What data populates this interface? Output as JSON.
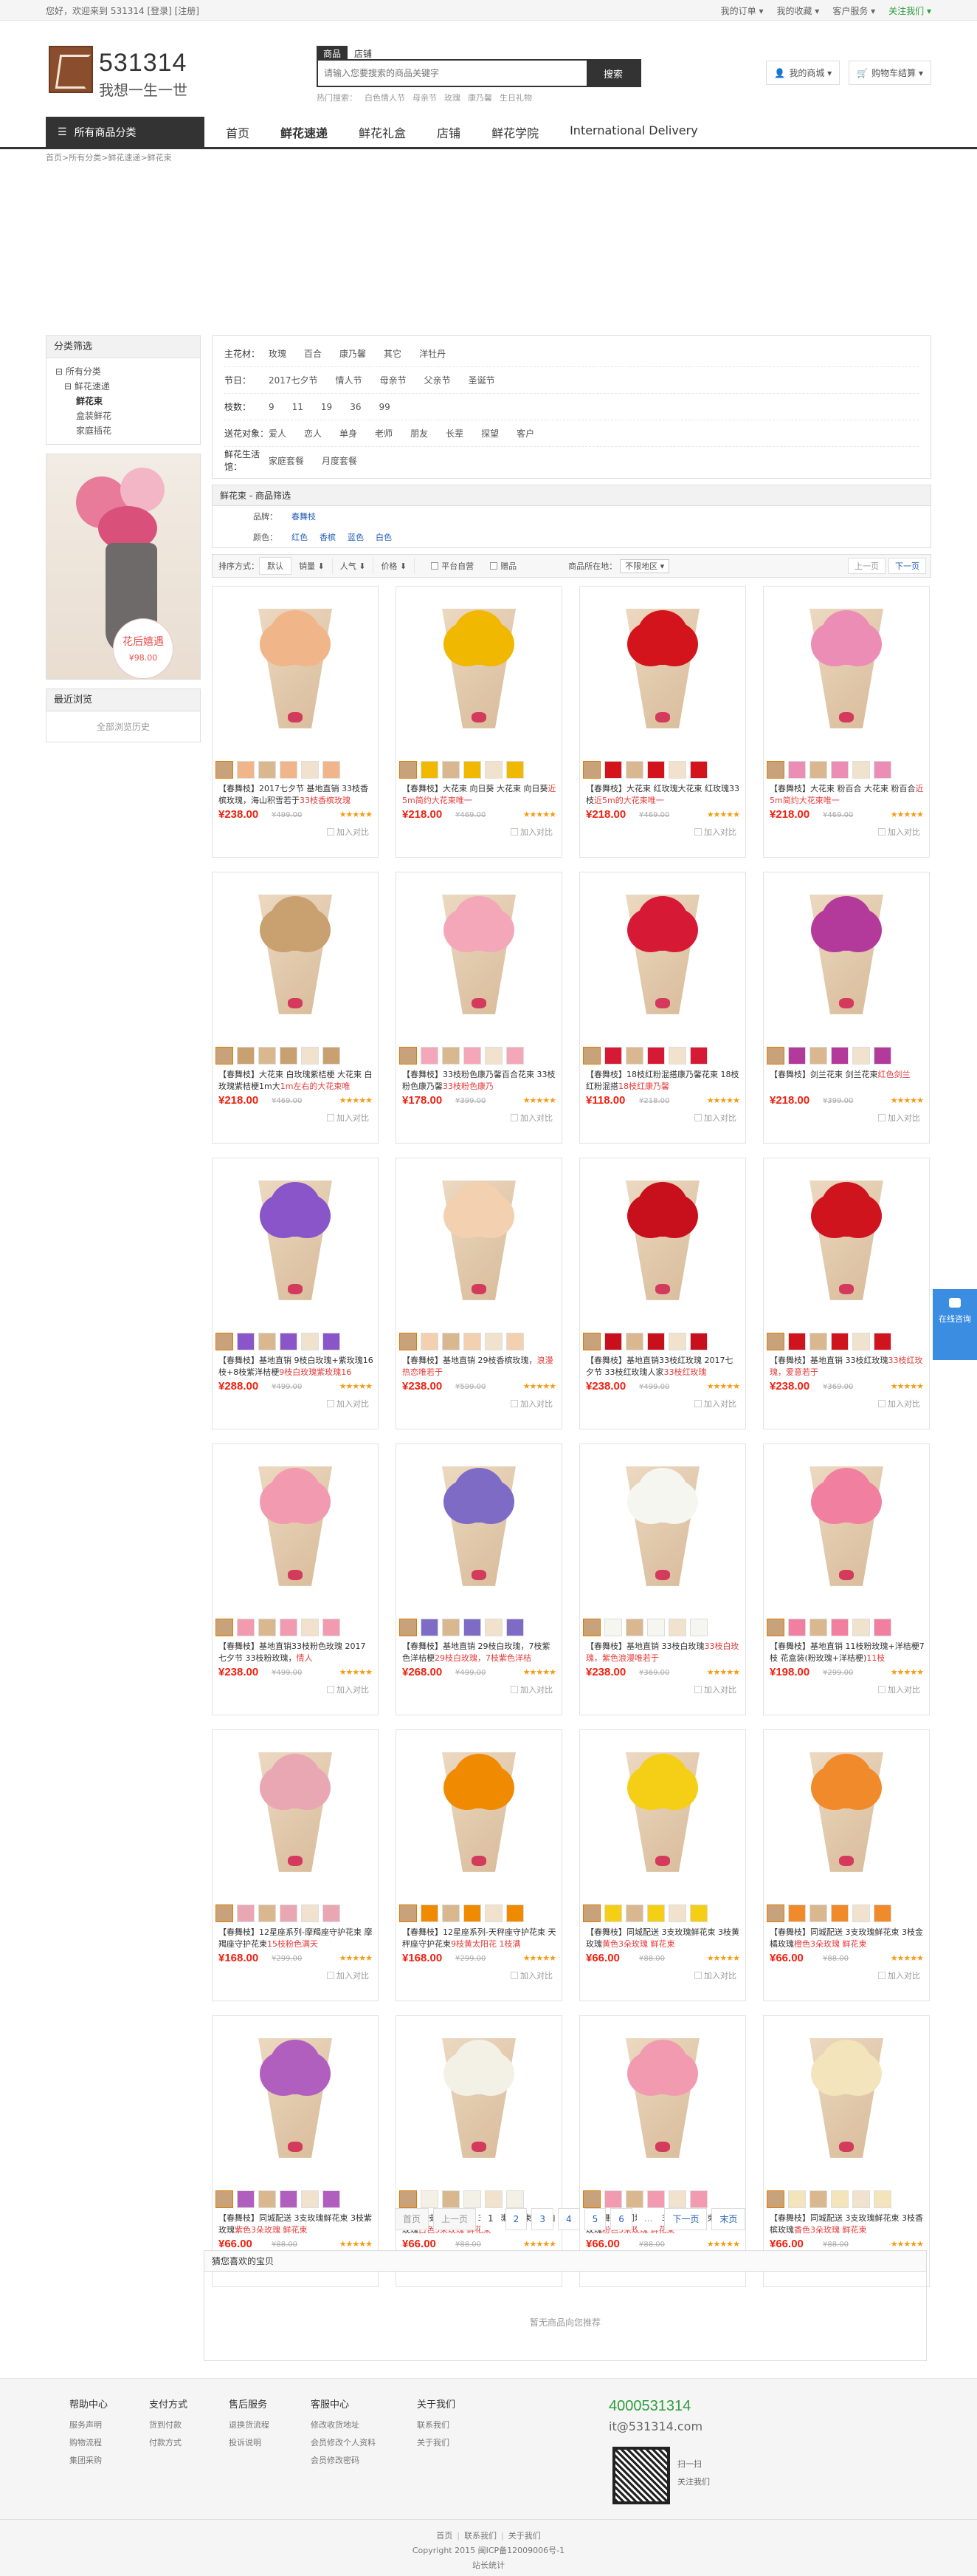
{
  "topbar": {
    "greeting": "您好，欢迎来到 531314 [登录] [注册]",
    "links": [
      "我的订单 ▾",
      "我的收藏 ▾",
      "客户服务 ▾",
      "关注我们 ▾"
    ]
  },
  "header": {
    "logo_num": "531314",
    "slogan": "我想一生一世",
    "tabs": [
      "商品",
      "店铺"
    ],
    "search_placeholder": "请输入您要搜索的商品关键字",
    "search_btn": "搜索",
    "hot_label": "热门搜索：",
    "hot": [
      "白色情人节",
      "母亲节",
      "玫瑰",
      "康乃馨",
      "生日礼物"
    ],
    "mall_btn": "我的商城 ▾",
    "cart_btn": "购物车结算 ▾"
  },
  "nav": {
    "allcat": "所有商品分类",
    "items": [
      "首页",
      "鲜花速递",
      "鲜花礼盒",
      "店铺",
      "鲜花学院",
      "International Delivery"
    ]
  },
  "breadcrumb": [
    "首页",
    "所有分类",
    "鲜花速递",
    "鲜花束"
  ],
  "sidebar": {
    "cat_title": "分类筛选",
    "tree": [
      [
        "l1",
        "⊟ 所有分类"
      ],
      [
        "l2",
        "⊟ 鲜花速递"
      ],
      [
        "l3 on",
        "鲜花束"
      ],
      [
        "l3",
        "盒装鲜花"
      ],
      [
        "l3",
        "家庭插花"
      ]
    ],
    "history_title": "最近浏览",
    "history_text": "全部浏览历史",
    "promo": {
      "line1": "花后嬉遇",
      "line2": "¥98.00"
    }
  },
  "filters": [
    {
      "k": "主花材：",
      "v": [
        "玫瑰",
        "百合",
        "康乃馨",
        "其它",
        "洋牡丹"
      ]
    },
    {
      "k": "节日：",
      "v": [
        "2017七夕节",
        "情人节",
        "母亲节",
        "父亲节",
        "圣诞节"
      ]
    },
    {
      "k": "枝数：",
      "v": [
        "9",
        "11",
        "19",
        "36",
        "99"
      ]
    },
    {
      "k": "送花对象：",
      "v": [
        "爱人",
        "恋人",
        "单身",
        "老师",
        "朋友",
        "长辈",
        "探望",
        "客户"
      ]
    },
    {
      "k": "鲜花生活馆：",
      "v": [
        "家庭套餐",
        "月度套餐"
      ]
    }
  ],
  "screen": {
    "title": "鲜花束 - 商品筛选",
    "rows": [
      {
        "k": "品牌：",
        "v": [
          "春舞枝"
        ]
      },
      {
        "k": "颜色：",
        "v": [
          "红色",
          "香槟",
          "蓝色",
          "白色"
        ]
      }
    ]
  },
  "sort": {
    "label": "排序方式：",
    "opts": [
      "默认",
      "销量 ⬇",
      "人气 ⬇",
      "价格 ⬇"
    ],
    "chk": [
      "平台自营",
      "赠品"
    ],
    "loc": "商品所在地：",
    "loc_val": "不限地区 ▾",
    "prev": "上一页",
    "next": "下一页"
  },
  "products": [
    {
      "c": "#f1b58a",
      "t": "【春舞枝】2017七夕节 基地直销 33枝香槟玫瑰，海山积雪若于",
      "h": "33枝香槟玫瑰",
      "p": "¥238.00",
      "o": "¥499.00"
    },
    {
      "c": "#f0b800",
      "t": "【春舞枝】大花束 向日葵 大花束 向日葵",
      "h": "近5m简约大花束唯一",
      "p": "¥218.00",
      "o": "¥469.00"
    },
    {
      "c": "#d3141c",
      "t": "【春舞枝】大花束 红玫瑰大花束 红玫瑰33枝",
      "h": "近5m的大花束唯一",
      "p": "¥218.00",
      "o": "¥469.00"
    },
    {
      "c": "#ec8db6",
      "t": "【春舞枝】大花束 粉百合 大花束 粉百合",
      "h": "近5m简约大花束唯一",
      "p": "¥218.00",
      "o": "¥469.00"
    },
    {
      "c": "#c9a070",
      "t": "【春舞枝】大花束 白玫瑰紫桔梗 大花束 白玫瑰紫桔梗1m大",
      "h": "1m左右的大花束唯",
      "p": "¥218.00",
      "o": "¥469.00"
    },
    {
      "c": "#f4a7b9",
      "t": "【春舞枝】33枝粉色康乃馨百合花束 33枝粉色康乃馨",
      "h": "33枝粉色康乃",
      "p": "¥178.00",
      "o": "¥399.00"
    },
    {
      "c": "#d61a36",
      "t": "【春舞枝】18枝红粉混搭康乃馨花束 18枝红粉混搭",
      "h": "18枝红康乃馨",
      "p": "¥118.00",
      "o": "¥218.00"
    },
    {
      "c": "#b33a9a",
      "t": "【春舞枝】剑兰花束 剑兰花束",
      "h": "红色剑兰",
      "p": "¥218.00",
      "o": "¥399.00"
    },
    {
      "c": "#8a55c8",
      "t": "【春舞枝】基地直销 9枝白玫瑰+紫玫瑰16枝+8枝紫洋桔梗",
      "h": "9枝白玫瑰紫玫瑰16",
      "p": "¥288.00",
      "o": "¥499.00"
    },
    {
      "c": "#f2d0b0",
      "t": "【春舞枝】基地直销 29枝香槟玫瑰，",
      "h": "浪漫热恋唯若于",
      "p": "¥238.00",
      "o": "¥599.00"
    },
    {
      "c": "#c8101c",
      "t": "【春舞枝】基地直销33枝红玫瑰 2017七夕节 33枝红玫瑰人家",
      "h": "33枝红玫瑰",
      "p": "¥238.00",
      "o": "¥499.00"
    },
    {
      "c": "#d0141e",
      "t": "【春舞枝】基地直销 33枝红玫瑰",
      "h": "33枝红玫瑰，爱意若于",
      "p": "¥238.00",
      "o": "¥369.00"
    },
    {
      "c": "#f29ab0",
      "t": "【春舞枝】基地直销33枝粉色玫瑰 2017七夕节 33枝粉玫瑰，",
      "h": "情人",
      "p": "¥238.00",
      "o": "¥499.00"
    },
    {
      "c": "#7d6bc6",
      "t": "【春舞枝】基地直销 29枝白玫瑰，7枝紫色洋桔梗",
      "h": "29枝白玫瑰，7枝紫色洋桔",
      "p": "¥268.00",
      "o": "¥499.00"
    },
    {
      "c": "#f6f6f0",
      "t": "【春舞枝】基地直销 33枝白玫瑰",
      "h": "33枝白玫瑰，紫色浪漫唯若于",
      "p": "¥238.00",
      "o": "¥369.00"
    },
    {
      "c": "#f07fa0",
      "t": "【春舞枝】基地直销 11枝粉玫瑰+洋桔梗7枝 花盒装(粉玫瑰+洋桔梗)",
      "h": "11枝",
      "p": "¥198.00",
      "o": "¥299.00"
    },
    {
      "c": "#e9a6b3",
      "t": "【春舞枝】12星座系列-摩羯座守护花束 摩羯座守护花束",
      "h": "15枝粉色满天",
      "p": "¥168.00",
      "o": "¥299.00"
    },
    {
      "c": "#f08a00",
      "t": "【春舞枝】12星座系列-天秤座守护花束 天秤座守护花束",
      "h": "9枝黄太阳花 1枝满",
      "p": "¥168.00",
      "o": "¥299.00"
    },
    {
      "c": "#f5cf15",
      "t": "【春舞枝】同城配送 3支玫瑰鲜花束 3枝黄玫瑰",
      "h": "黄色3朵玫瑰 鲜花束",
      "p": "¥66.00",
      "o": "¥88.00"
    },
    {
      "c": "#f08a2a",
      "t": "【春舞枝】同城配送 3支玫瑰鲜花束 3枝金橘玫瑰",
      "h": "橙色3朵玫瑰 鲜花束",
      "p": "¥66.00",
      "o": "¥88.00"
    },
    {
      "c": "#b15fbf",
      "t": "【春舞枝】同城配送 3支玫瑰鲜花束 3枝紫玫瑰",
      "h": "紫色3朵玫瑰 鲜花束",
      "p": "¥66.00",
      "o": "¥88.00"
    },
    {
      "c": "#f3f0e6",
      "t": "【春舞枝】同城配送 3支玫瑰鲜花束 3枝白玫瑰",
      "h": "白色3朵玫瑰 鲜花束",
      "p": "¥66.00",
      "o": "¥88.00"
    },
    {
      "c": "#f29bb0",
      "t": "【春舞枝】同城配送 3支玫瑰鲜花束 3枝粉玫瑰",
      "h": "粉色3朵玫瑰 鲜花束",
      "p": "¥66.00",
      "o": "¥88.00"
    },
    {
      "c": "#f3e4bb",
      "t": "【春舞枝】同城配送 3支玫瑰鲜花束 3枝香槟玫瑰",
      "h": "香色3朵玫瑰 鲜花束",
      "p": "¥66.00",
      "o": "¥88.00"
    }
  ],
  "stars": "★★★★★",
  "compare": "加入对比",
  "pager": [
    "首页",
    "上一页",
    "1",
    "2",
    "3",
    "4",
    "5",
    "6",
    "...",
    "下一页",
    "末页"
  ],
  "recommend": {
    "title": "猜您喜欢的宝贝",
    "empty": "暂无商品向您推荐"
  },
  "footer": {
    "cols": [
      {
        "h": "帮助中心",
        "i": [
          "服务声明",
          "购物流程",
          "集团采购"
        ]
      },
      {
        "h": "支付方式",
        "i": [
          "货到付款",
          "付款方式"
        ]
      },
      {
        "h": "售后服务",
        "i": [
          "退换货流程",
          "投诉说明"
        ]
      },
      {
        "h": "客服中心",
        "i": [
          "修改收货地址",
          "会员修改个人资料",
          "会员修改密码"
        ]
      },
      {
        "h": "关于我们",
        "i": [
          "联系我们",
          "关于我们"
        ]
      }
    ],
    "tel": "4000531314",
    "mail": "it@531314.com",
    "qr_text": [
      "扫一扫",
      "关注我们"
    ],
    "links": [
      "首页",
      "联系我们",
      "关于我们"
    ],
    "copy": "Copyright 2015 闽ICP备12009006号-1",
    "stat": "站长统计"
  },
  "service": "在线咨询"
}
